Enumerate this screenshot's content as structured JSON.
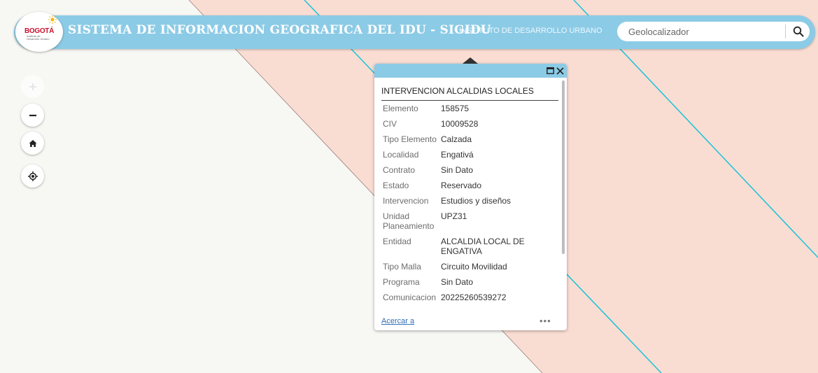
{
  "header": {
    "logo_text": "BOGOTÁ",
    "logo_subtext": "Instituto de Desarrollo Urbano",
    "title": "SISTEMA DE INFORMACION GEOGRAFICA DEL IDU - SIGIDU",
    "institution": "INSTITUTO DE DESARROLLO URBANO"
  },
  "search": {
    "placeholder": "Geolocalizador",
    "value": "",
    "icon": "search-icon"
  },
  "map_controls": [
    {
      "name": "zoom-in-button",
      "icon": "plus-icon"
    },
    {
      "name": "zoom-out-button",
      "icon": "minus-icon"
    },
    {
      "name": "home-button",
      "icon": "home-icon"
    },
    {
      "name": "locate-button",
      "icon": "locate-icon"
    }
  ],
  "popup": {
    "title": "INTERVENCION ALCALDIAS LOCALES",
    "attributes": [
      {
        "key": "Elemento",
        "value": "158575"
      },
      {
        "key": "CIV",
        "value": "10009528"
      },
      {
        "key": "Tipo Elemento",
        "value": "Calzada"
      },
      {
        "key": "Localidad",
        "value": "Engativá"
      },
      {
        "key": "Contrato",
        "value": "Sin Dato"
      },
      {
        "key": "Estado",
        "value": "Reservado"
      },
      {
        "key": "Intervencion",
        "value": "Estudios y diseños"
      },
      {
        "key": "Unidad Planeamiento",
        "value": "UPZ31"
      },
      {
        "key": "Entidad",
        "value": "ALCALDIA LOCAL DE ENGATIVA"
      },
      {
        "key": "Tipo Malla",
        "value": "Circuito Movilidad"
      },
      {
        "key": "Programa",
        "value": "Sin Dato"
      },
      {
        "key": "Comunicacion",
        "value": "20225260539272"
      }
    ],
    "zoom_link": "Acercar a",
    "more": "•••",
    "maximize_icon": "maximize-icon",
    "close_icon": "close-icon"
  },
  "colors": {
    "header_bg": "#8ccbe6",
    "map_bg": "#f7f7f3",
    "feature_fill": "#f9ddd3",
    "feature_line": "#1bc3d8",
    "link": "#2f6fb8"
  }
}
